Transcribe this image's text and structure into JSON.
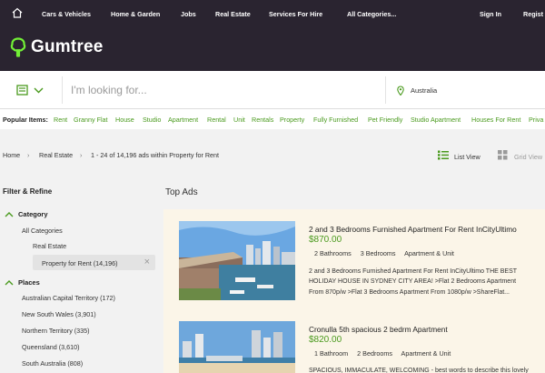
{
  "nav": {
    "items": [
      "Cars & Vehicles",
      "Home & Garden",
      "Jobs",
      "Real Estate",
      "Services For Hire",
      "All Categories..."
    ],
    "signin": "Sign In",
    "register": "Regist"
  },
  "brand": {
    "name": "Gumtree"
  },
  "search": {
    "placeholder": "I'm looking for...",
    "location": "Australia"
  },
  "popular": {
    "label": "Popular Items:",
    "items": [
      "Rent",
      "Granny Flat",
      "House",
      "Studio",
      "Apartment",
      "Rental",
      "Unit",
      "Rentals",
      "Property",
      "Fully Furnished",
      "Pet Friendly",
      "Studio Apartment",
      "Houses For Rent",
      "Priva"
    ]
  },
  "breadcrumb": {
    "home": "Home",
    "category": "Real Estate",
    "summary": "1 - 24 of 14,196 ads within Property for Rent"
  },
  "view": {
    "list": "List View",
    "grid": "Grid View"
  },
  "sidebar": {
    "title": "Filter & Refine",
    "category_heading": "Category",
    "all_categories": "All Categories",
    "real_estate": "Real Estate",
    "selected": "Property for Rent (14,196)",
    "places_heading": "Places",
    "places": [
      "Australian Capital Territory (172)",
      "New South Wales (3,901)",
      "Northern Territory (335)",
      "Queensland (3,610)",
      "South Australia (808)"
    ]
  },
  "main": {
    "top_ads_title": "Top Ads",
    "ads": [
      {
        "title": "2 and 3 Bedrooms Furnished Apartment For Rent InCityUltimo",
        "price": "$870.00",
        "attrs": [
          "2 Bathrooms",
          "3 Bedrooms",
          "Apartment & Unit"
        ],
        "desc": [
          "2 and 3 Bedrooms Furnished Apartment For Rent InCityUltimo THE BEST",
          "HOLIDAY HOUSE IN SYDNEY CITY AREA! >Flat 2 Bedrooms Apartment",
          "From 870p/w >Flat 3 Bedrooms Apartment From 1080p/w >ShareFlat..."
        ]
      },
      {
        "title": "Cronulla 5th spacious 2 bedrm Apartment",
        "price": "$820.00",
        "attrs": [
          "1 Bathroom",
          "2 Bedrooms",
          "Apartment & Unit"
        ],
        "desc": [
          "SPACIOUS, IMMACULATE, WELCOMING - best words to describe this lovely"
        ]
      }
    ]
  },
  "colors": {
    "nav_bg": "#2a2430",
    "brand_green": "#72ef36",
    "link_green": "#4a9a1e",
    "ad_bg": "#fbf5e8"
  }
}
